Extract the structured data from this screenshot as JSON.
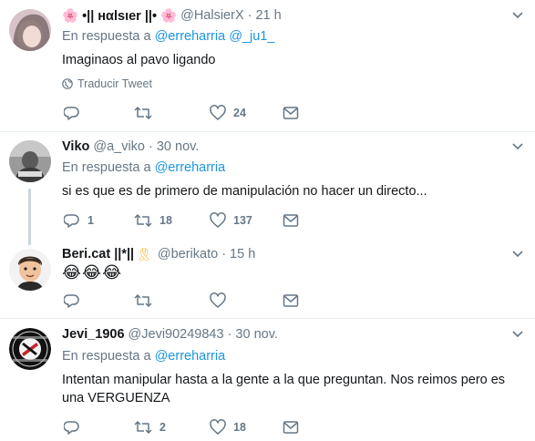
{
  "colors": {
    "link": "#1b95e0",
    "muted": "#657786",
    "divider": "#e6ecf0",
    "thread_line": "#ccd6dd"
  },
  "tweets": [
    {
      "name_prefix": "🌸 •|| нαlѕιer ||• 🌸",
      "handle": "@HalsierX",
      "time": "21 h",
      "reply_label": "En respuesta a",
      "reply_users": [
        "@erreharria",
        "@_ju1_"
      ],
      "text": "Imaginaos al pavo ligando",
      "translate": "Traducir Tweet",
      "replies": "",
      "retweets": "",
      "likes": "24"
    },
    {
      "name": "Viko",
      "handle": "@a_viko",
      "time": "30 nov.",
      "reply_label": "En respuesta a",
      "reply_users": [
        "@erreharria"
      ],
      "text": "si es que es de primero de manipulación no hacer un directo...",
      "replies": "1",
      "retweets": "18",
      "likes": "137"
    },
    {
      "name": "Beri.cat ||*||",
      "ribbon": "🎗",
      "handle": "@berikato",
      "time": "15 h",
      "text": "😂😂😂",
      "replies": "",
      "retweets": "",
      "likes": ""
    },
    {
      "name": "Jevi_1906",
      "handle": "@Jevi90249843",
      "time": "30 nov.",
      "reply_label": "En respuesta a",
      "reply_users": [
        "@erreharria"
      ],
      "text": "Intentan manipular hasta a la gente a la que preguntan. Nos reimos pero es una VERGUENZA",
      "replies": "",
      "retweets": "2",
      "likes": "18"
    }
  ]
}
